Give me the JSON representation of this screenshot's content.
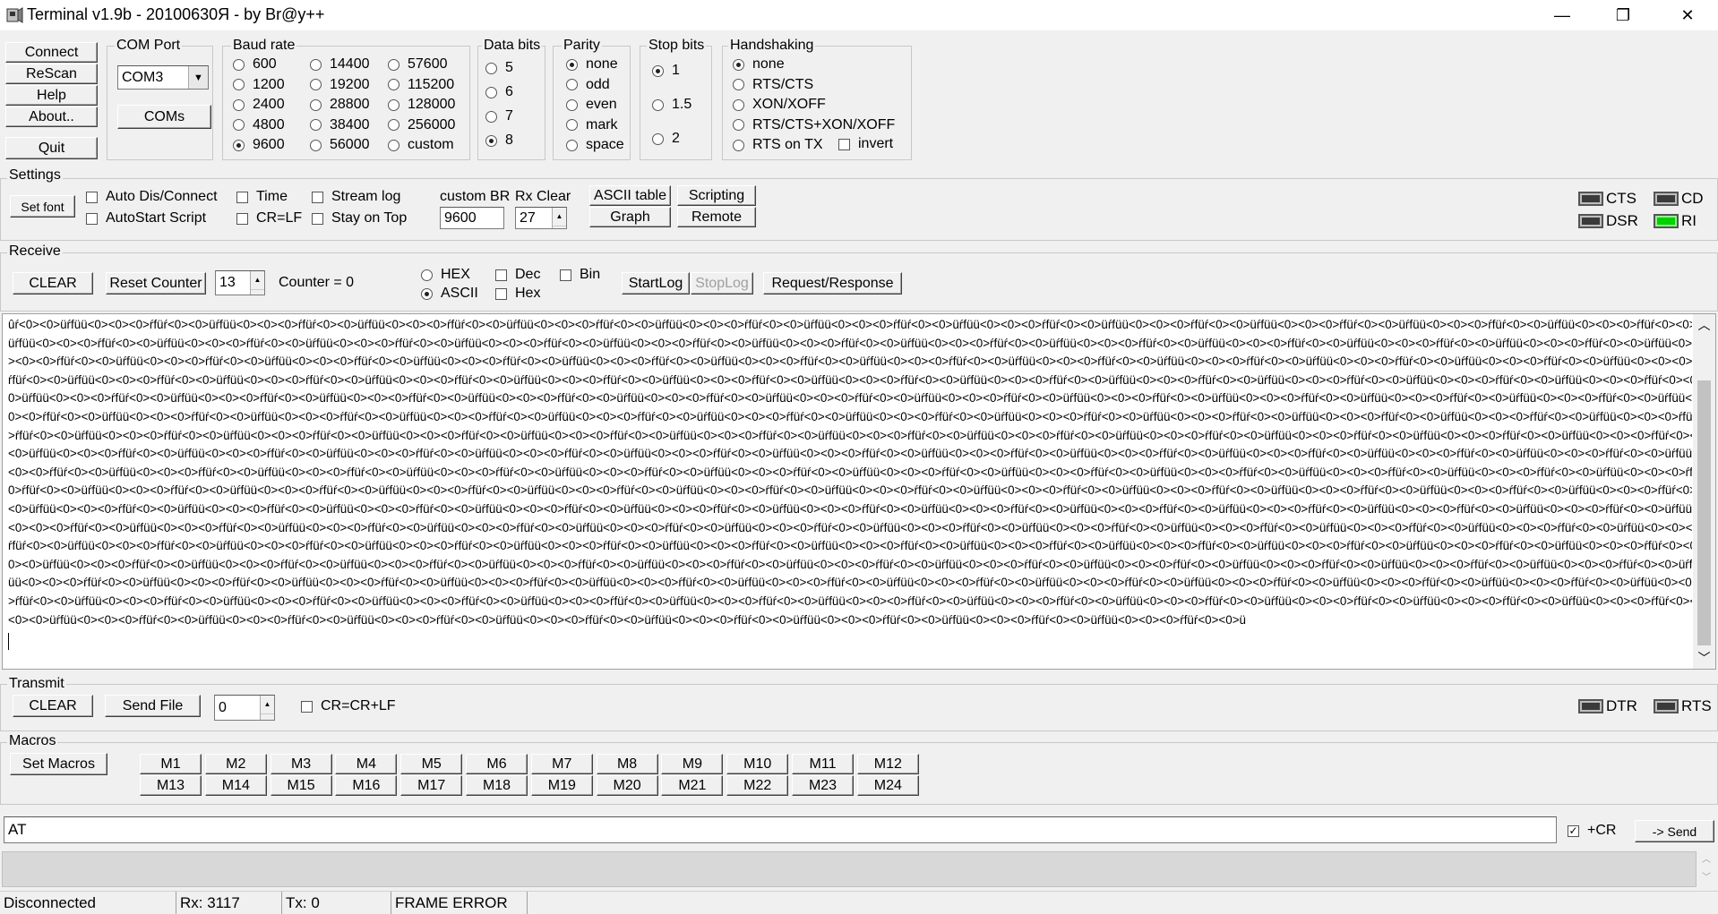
{
  "window": {
    "title": "Terminal v1.9b - 20100630Я - by Br@y++",
    "minimize": "—",
    "restore": "❐",
    "close": "✕"
  },
  "connect": {
    "connect": "Connect",
    "rescan": "ReScan",
    "help": "Help",
    "about": "About..",
    "quit": "Quit"
  },
  "com_port": {
    "title": "COM Port",
    "value": "COM3",
    "coms_button": "COMs"
  },
  "baud_rate": {
    "title": "Baud rate",
    "options": [
      "600",
      "1200",
      "2400",
      "4800",
      "9600",
      "14400",
      "19200",
      "28800",
      "38400",
      "56000",
      "57600",
      "115200",
      "128000",
      "256000",
      "custom"
    ],
    "selected": "9600"
  },
  "data_bits": {
    "title": "Data bits",
    "options": [
      "5",
      "6",
      "7",
      "8"
    ],
    "selected": "8"
  },
  "parity": {
    "title": "Parity",
    "options": [
      "none",
      "odd",
      "even",
      "mark",
      "space"
    ],
    "selected": "none"
  },
  "stop_bits": {
    "title": "Stop bits",
    "options": [
      "1",
      "1.5",
      "2"
    ],
    "selected": "1"
  },
  "handshaking": {
    "title": "Handshaking",
    "options": [
      "none",
      "RTS/CTS",
      "XON/XOFF",
      "RTS/CTS+XON/XOFF",
      "RTS on TX"
    ],
    "selected": "none",
    "invert_label": "invert"
  },
  "settings": {
    "title": "Settings",
    "set_font": "Set font",
    "auto_dis_connect": "Auto Dis/Connect",
    "autostart_script": "AutoStart Script",
    "time": "Time",
    "cr_lf": "CR=LF",
    "stream_log": "Stream log",
    "stay_on_top": "Stay on Top",
    "custom_br_label": "custom BR",
    "custom_br_value": "9600",
    "rx_clear_label": "Rx Clear",
    "rx_clear_value": "27",
    "ascii_table": "ASCII table",
    "scripting": "Scripting",
    "graph": "Graph",
    "remote": "Remote",
    "leds": {
      "cts": "CTS",
      "cd": "CD",
      "dsr": "DSR",
      "ri": "RI"
    },
    "led_on_color": "#00d000"
  },
  "receive": {
    "title": "Receive",
    "clear": "CLEAR",
    "reset_counter": "Reset Counter",
    "counter_spin": "13",
    "counter_label": "Counter = 0",
    "hex": "HEX",
    "ascii": "ASCII",
    "selected_mode": "ASCII",
    "dec": "Dec",
    "hex_check": "Hex",
    "bin": "Bin",
    "startlog": "StartLog",
    "stoplog": "StopLog",
    "request_response": "Request/Response",
    "lines": [
      "ûŕ<0><0>üŕfüü<0><0><0>ŕfüŕ<0><0>üŕfüü<0><0><0>ŕfüŕ<0><0>üŕfüü<0><0><0>ŕfüŕ<0><0>üŕfüü<0><0><0>ŕfüŕ<0><0>üŕfüü<0><0><0>ŕfüŕ<0><0>üŕfüü<0><0><0>ŕfüŕ<0><0>üŕfüü<0><0><0>ŕfüŕ<0><0>üŕfüü<0><0><0>ŕfüŕ<0><0>üŕfüü<0><0><0>ŕfüŕ<0><0>üŕfüü<0><0><0>ŕfüŕ<0><0>üŕfüü<0><0><0>ŕfüŕ<0><0>üŕfüü<0><0><0>ŕfüŕ<0><0",
      "üŕfüü<0><0><0>ŕfüŕ<0><0>üŕfüü<0><0><0>ŕfüŕ<0><0>üŕfüü<0><0><0>ŕfüŕ<0><0>üŕfüü<0><0><0>ŕfüŕ<0><0>üŕfüü<0><0><0>ŕfüŕ<0><0>üŕfüü<0><0><0>ŕfüŕ<0><0>üŕfüü<0><0><0>ŕfüŕ<0><0>üŕfüü<0><0><0>ŕfüŕ<0><0>üŕfüü<0><0><0>ŕfüŕ<0><0>üŕfüü<0><0><0>ŕfüŕ<0><0>üŕfüü<0><0><0>ŕfüŕ<0><0>üŕfüü<0><0><0>ŕfüŕ<0><0>üŕfüü<0",
      "><0><0>ŕfüŕ<0><0>üŕfüü<0><0><0>ŕfüŕ<0><0>üŕfüü<0><0><0>ŕfüŕ<0><0>üŕfüü<0><0><0>ŕfüŕ<0><0>üŕfüü<0><0><0>ŕfüŕ<0><0>üŕfüü<0><0><0>ŕfüŕ<0><0>üŕfüü<0><0><0>ŕfüŕ<0><0>üŕfüü<0><0><0>ŕfüŕ<0><0>üŕfüü<0><0><0>ŕfüŕ<0><0>üŕfüü<0><0><0>ŕfüŕ<0><0>üŕfüü<0><0><0>ŕfüŕ<0><0>üŕfüü<0><0><0>ŕfüŕ<0><0>üŕfüü<0><0><0",
      "ŕfüŕ<0><0>üŕfüü<0><0><0>ŕfüŕ<0><0>üŕfüü<0><0><0>ŕfüŕ<0><0>üŕfüü<0><0><0>ŕfüŕ<0><0>üŕfüü<0><0><0>ŕfüŕ<0><0>üŕfüü<0><0><0>ŕfüŕ<0><0>üŕfüü<0><0><0>ŕfüŕ<0><0>üŕfüü<0><0><0>ŕfüŕ<0><0>üŕfüü<0><0><0>ŕfüŕ<0><0>üŕfüü<0><0><0>ŕfüŕ<0><0>üŕfüü<0><0><0>ŕfüŕ<0><0>üŕfüü<0><0><0>ŕfüŕ<0><0>üŕfüü<0><0><0>ŕfüŕ<",
      "0>üŕfüü<0><0><0>ŕfüŕ<0><0>üŕfüü<0><0><0>ŕfüŕ<0><0>üŕfüü<0><0><0>ŕfüŕ<0><0>üŕfüü<0><0><0>ŕfüŕ<0><0>üŕfüü<0><0><0>ŕfüŕ<0><0>üŕfüü<0><0><0>ŕfüŕ<0><0>üŕfüü<0><0><0>ŕfüŕ<0><0>üŕfüü<0><0><0>ŕfüŕ<0><0>üŕfüü<0><0><0>ŕfüŕ<0><0>üŕfüü<0><0><0>ŕfüŕ<0><0>üŕfüü<0><0><0>ŕfüŕ<0><0>üŕfüü<0><0><0>ŕfüŕ<0><0>üŕfüü<",
      "0><0>ŕfüŕ<0><0>üŕfüü<0><0><0>ŕfüŕ<0><0>üŕfüü<0><0><0>ŕfüŕ<0><0>üŕfüü<0><0><0>ŕfüŕ<0><0>üŕfüü<0><0><0>ŕfüŕ<0><0>üŕfüü<0><0><0>ŕfüŕ<0><0>üŕfüü<0><0><0>ŕfüŕ<0><0>üŕfüü<0><0><0>ŕfüŕ<0><0>üŕfüü<0><0><0>ŕfüŕ<0><0>üŕfüü<0><0><0>ŕfüŕ<0><0>üŕfüü<0><0><0>ŕfüŕ<0><0>üŕfüü<0><0><0>ŕfüŕ<0><0>üŕfüü<0><0><",
      ">ŕfüŕ<0><0>üŕfüü<0><0><0>ŕfüŕ<0><0>üŕfüü<0><0><0>ŕfüŕ<0><0>üŕfüü<0><0><0>ŕfüŕ<0><0>üŕfüü<0><0><0>ŕfüŕ<0><0>üŕfüü<0><0><0>ŕfüŕ<0><0>üŕfüü<0><0><0>ŕfüŕ<0><0>üŕfüü<0><0><0>ŕfüŕ<0><0>üŕfüü<0><0><0>ŕfüŕ<0><0>üŕfüü<0><0><0>ŕfüŕ<0><0>üŕfüü<0><0><0>ŕfüŕ<0><0>üŕfüü<0><0><0>ŕfüŕ<0><0>üŕfüü<0><0><0>ŕfüŕ<0",
      "<0>üŕfüü<0><0><0>ŕfüŕ<0><0>üŕfüü<0><0><0>ŕfüŕ<0><0>üŕfüü<0><0><0>ŕfüŕ<0><0>üŕfüü<0><0><0>ŕfüŕ<0><0>üŕfüü<0><0><0>ŕfüŕ<0><0>üŕfüü<0><0><0>ŕfüŕ<0><0>üŕfüü<0><0><0>ŕfüŕ<0><0>üŕfüü<0><0><0>ŕfüŕ<0><0>üŕfüü<0><0><0>ŕfüŕ<0><0>üŕfüü<0><0><0>ŕfüŕ<0><0>üŕfüü<0><0><0>ŕfüŕ<0><0>üŕfüü<0><0><0>ŕfüŕ<0><0>üŕfüü",
      "<0><0>ŕfüŕ<0><0>üŕfüü<0><0><0>ŕfüŕ<0><0>üŕfüü<0><0><0>ŕfüŕ<0><0>üŕfüü<0><0><0>ŕfüŕ<0><0>üŕfüü<0><0><0>ŕfüŕ<0><0>üŕfüü<0><0><0>ŕfüŕ<0><0>üŕfüü<0><0><0>ŕfüŕ<0><0>üŕfüü<0><0><0>ŕfüŕ<0><0>üŕfüü<0><0><0>ŕfüŕ<0><0>üŕfüü<0><0><0>ŕfüŕ<0><0>üŕfüü<0><0><0>ŕfüŕ<0><0>üŕfüü<0><0><0>ŕfüŕ<0><0>üŕfüü<0><0><0>ŕfüŕ<0><",
      "0>ŕfüŕ<0><0>üŕfüü<0><0><0>ŕfüŕ<0><0>üŕfüü<0><0><0>ŕfüŕ<0><0>üŕfüü<0><0><0>ŕfüŕ<0><0>üŕfüü<0><0><0>ŕfüŕ<0><0>üŕfüü<0><0><0>ŕfüŕ<0><0>üŕfüü<0><0><0>ŕfüŕ<0><0>üŕfüü<0><0><0>ŕfüŕ<0><0>üŕfüü<0><0><0>ŕfüŕ<0><0>üŕfüü<0><0><0>ŕfüŕ<0><0>üŕfüü<0><0><0>ŕfüŕ<0><0>üŕfüü<0><0><0>ŕfüŕ<0><0>üŕfüü<0><0><0>ŕfüŕ<0>",
      "<0>üŕfüü<0><0><0>ŕfüŕ<0><0>üŕfüü<0><0><0>ŕfüŕ<0><0>üŕfüü<0><0><0>ŕfüŕ<0><0>üŕfüü<0><0><0>ŕfüŕ<0><0>üŕfüü<0><0><0>ŕfüŕ<0><0>üŕfüü<0><0><0>ŕfüŕ<0><0>üŕfüü<0><0><0>ŕfüŕ<0><0>üŕfüü<0><0><0>ŕfüŕ<0><0>üŕfüü<0><0><0>ŕfüŕ<0><0>üŕfüü<0><0><0>ŕfüŕ<0><0>üŕfüü<0><0><0>ŕfüŕ<0><0>üŕfüü<0><0><0>ŕfüŕ<0><0>üŕfüü",
      "<0><0><0>ŕfüŕ<0><0>üŕfüü<0><0><0>ŕfüŕ<0><0>üŕfüü<0><0><0>ŕfüŕ<0><0>üŕfüü<0><0><0>ŕfüŕ<0><0>üŕfüü<0><0><0>ŕfüŕ<0><0>üŕfüü<0><0><0>ŕfüŕ<0><0>üŕfüü<0><0><0>ŕfüŕ<0><0>üŕfüü<0><0><0>ŕfüŕ<0><0>üŕfüü<0><0><0>ŕfüŕ<0><0>üŕfüü<0><0><0>ŕfüŕ<0><0>üŕfüü<0><0><0>ŕfüŕ<0><0>üŕfüü<0><0><0>ŕfüŕ<0><0>üŕfüü<0><0><0",
      "ŕfüŕ<0><0>üŕfüü<0><0><0>ŕfüŕ<0><0>üŕfüü<0><0><0>ŕfüŕ<0><0>üŕfüü<0><0><0>ŕfüŕ<0><0>üŕfüü<0><0><0>ŕfüŕ<0><0>üŕfüü<0><0><0>ŕfüŕ<0><0>üŕfüü<0><0><0>ŕfüŕ<0><0>üŕfüü<0><0><0>ŕfüŕ<0><0>üŕfüü<0><0><0>ŕfüŕ<0><0>üŕfüü<0><0><0>ŕfüŕ<0><0>üŕfüü<0><0><0>ŕfüŕ<0><0>üŕfüü<0><0><0>ŕfüŕ<0><0>üŕfüü<0><0><0>ŕfüŕ<",
      "0><0>üŕfüü<0><0><0>ŕfüŕ<0><0>üŕfüü<0><0><0>ŕfüŕ<0><0>üŕfüü<0><0><0>ŕfüŕ<0><0>üŕfüü<0><0><0>ŕfüŕ<0><0>üŕfüü<0><0><0>ŕfüŕ<0><0>üŕfüü<0><0><0>ŕfüŕ<0><0>üŕfüü<0><0><0>ŕfüŕ<0><0>üŕfüü<0><0><0>ŕfüŕ<0><0>üŕfüü<0><0><0>ŕfüŕ<0><0>üŕfüü<0><0><0>ŕfüŕ<0><0>üŕfüü<0><0><0>ŕfüŕ<0><0>üŕfüü<0><0><0>ŕfüŕ<0><0>üŕf",
      "üü<0><0><0>ŕfüŕ<0><0>üŕfüü<0><0><0>ŕfüŕ<0><0>üŕfüü<0><0><0>ŕfüŕ<0><0>üŕfüü<0><0><0>ŕfüŕ<0><0>üŕfüü<0><0><0>ŕfüŕ<0><0>üŕfüü<0><0><0>ŕfüŕ<0><0>üŕfüü<0><0><0>ŕfüŕ<0><0>üŕfüü<0><0><0>ŕfüŕ<0><0>üŕfüü<0><0><0>ŕfüŕ<0><0>üŕfüü<0><0><0>ŕfüŕ<0><0>üŕfüü<0><0><0>ŕfüŕ<0><0>üŕfüü<0><0><0>ŕfüŕ<0><0>üŕfüü<0><0><0",
      ">ŕfüŕ<0><0>üŕfüü<0><0><0>ŕfüŕ<0><0>üŕfüü<0><0><0>ŕfüŕ<0><0>üŕfüü<0><0><0>ŕfüŕ<0><0>üŕfüü<0><0><0>ŕfüŕ<0><0>üŕfüü<0><0><0>ŕfüŕ<0><0>üŕfüü<0><0><0>ŕfüŕ<0><0>üŕfüü<0><0><0>ŕfüŕ<0><0>üŕfüü<0><0><0>ŕfüŕ<0><0>üŕfüü<0><0><0>ŕfüŕ<0><0>üŕfüü<0><0><0>ŕfüŕ<0><0>üŕfüü<0><0><0>ŕfüŕ<0><0>üŕfüü<0><0><0>ŕfüŕ",
      "<0><0>üŕfüü<0><0><0>ŕfüŕ<0><0>üŕfüü<0><0><0>ŕfüŕ<0><0>üŕfüü<0><0><0>ŕfüŕ<0><0>üŕfüü<0><0><0>ŕfüŕ<0><0>üŕfüü<0><0><0>ŕfüŕ<0><0>üŕfüü<0><0><0>ŕfüŕ<0><0>üŕfüü<0><0><0>ŕfüŕ<0><0>üŕfüü<0><0><0>ŕfüŕ<0><0>ü"
    ]
  },
  "transmit": {
    "title": "Transmit",
    "clear": "CLEAR",
    "send_file": "Send File",
    "spin_value": "0",
    "cr_crlf": "CR=CR+LF",
    "dtr": "DTR",
    "rts": "RTS"
  },
  "macros": {
    "title": "Macros",
    "set_macros": "Set Macros",
    "row1": [
      "M1",
      "M2",
      "M3",
      "M4",
      "M5",
      "M6",
      "M7",
      "M8",
      "M9",
      "M10",
      "M11",
      "M12"
    ],
    "row2": [
      "M13",
      "M14",
      "M15",
      "M16",
      "M17",
      "M18",
      "M19",
      "M20",
      "M21",
      "M22",
      "M23",
      "M24"
    ]
  },
  "send": {
    "input_value": "AT",
    "plus_cr": "+CR",
    "send_button": "-> Send"
  },
  "status": {
    "connection": "Disconnected",
    "rx": "Rx: 3117",
    "tx": "Tx: 0",
    "error": "FRAME ERROR"
  }
}
